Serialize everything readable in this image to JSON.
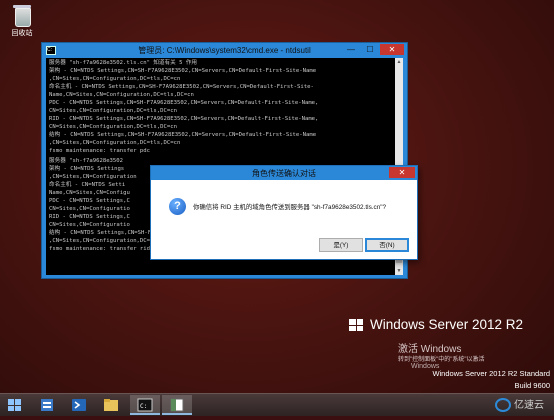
{
  "desktop": {
    "recycle_bin_label": "回收站"
  },
  "cmd_window": {
    "title": "管理员: C:\\Windows\\system32\\cmd.exe - ntdsutil",
    "minimize": "—",
    "maximize": "☐",
    "close": "✕",
    "lines": [
      "服务器 \"sh-f7a9628e3502.tls.cn\" 知道有关 5 作用",
      "架构 - CN=NTDS Settings,CN=SH-F7A9628E3502,CN=Servers,CN=Default-First-Site-Name",
      ",CN=Sites,CN=Configuration,DC=tls,DC=cn",
      "命名主机 - CN=NTDS Settings,CN=SH-F7A9628E3502,CN=Servers,CN=Default-First-Site-",
      "Name,CN=Sites,CN=Configuration,DC=tls,DC=cn",
      "PDC - CN=NTDS Settings,CN=SH-F7A9628E3502,CN=Servers,CN=Default-First-Site-Name,",
      "CN=Sites,CN=Configuration,DC=tls,DC=cn",
      "RID - CN=NTDS Settings,CN=SH-F7A9628E3502,CN=Servers,CN=Default-First-Site-Name,",
      "CN=Sites,CN=Configuration,DC=tls,DC=cn",
      "结构 - CN=NTDS Settings,CN=SH-F7A9628E3502,CN=Servers,CN=Default-First-Site-Name",
      ",CN=Sites,CN=Configuration,DC=tls,DC=cn",
      "fsmo maintenance: transfer pdc",
      "服务器 \"sh-f7a9628e3502",
      "架构 - CN=NTDS Settings",
      ",CN=Sites,CN=Configuration",
      "命名主机 - CN=NTDS Setti",
      "Name,CN=Sites,CN=Configu",
      "PDC - CN=NTDS Settings,C",
      "CN=Sites,CN=Configuratio",
      "RID - CN=NTDS Settings,C",
      "CN=Sites,CN=Configuratio",
      "结构 - CN=NTDS Settings,CN=SH-F7A9628E3502,CN=Servers,CN=Default-First-Site-Name",
      ",CN=Sites,CN=Configuration,DC=tls,DC=cn",
      "fsmo maintenance: transfer rid master"
    ]
  },
  "dialog": {
    "title": "角色传送确认对话",
    "close": "✕",
    "message": "你确信将 RID 主机的域角色传送到服务器 \"sh-f7a9628e3502.tls.cn\"?",
    "yes_label": "是(Y)",
    "no_label": "否(N)"
  },
  "branding": {
    "product": "Windows Server 2012 R2",
    "activate_title": "激活 Windows",
    "activate_sub": "转到\"控制面板\"中的\"系统\"以激活",
    "activate_word": "Windows",
    "edition": "Windows Server 2012 R2 Standard",
    "build": "Build 9600"
  },
  "watermark": {
    "text": "亿速云"
  },
  "colors": {
    "accent": "#2b88d8",
    "close_red": "#c7372f"
  }
}
